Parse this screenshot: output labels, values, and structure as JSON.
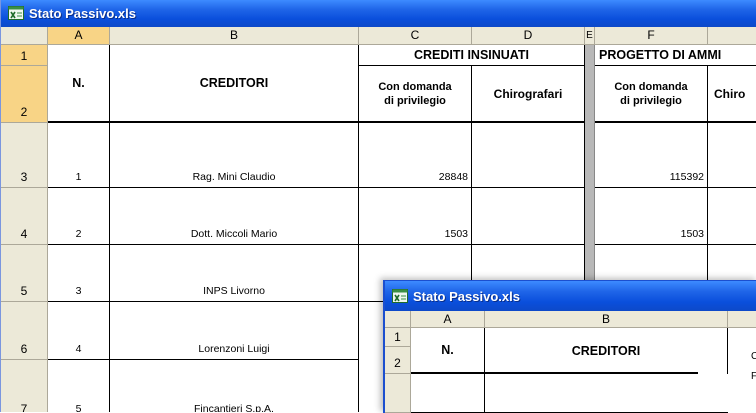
{
  "window_main": {
    "title": "Stato Passivo.xls",
    "columns": [
      "A",
      "B",
      "C",
      "D",
      "E",
      "F"
    ],
    "row_headers": [
      "1",
      "2",
      "3",
      "4",
      "5",
      "6",
      "7"
    ],
    "header": {
      "n_label": "N.",
      "creditori_label": "CREDITORI",
      "crediti_insinuati": "CREDITI INSINUATI",
      "progetto": "PROGETTO DI AMMI",
      "con_domanda": "Con domanda di privilegio",
      "con_domanda_line1": "Con domanda",
      "con_domanda_line2": "di privilegio",
      "chirografari": "Chirografari",
      "chiro_partial": "Chiro"
    },
    "rows": [
      {
        "n": "1",
        "creditore": "Rag. Mini Claudio",
        "c": "28848",
        "f": "115392"
      },
      {
        "n": "2",
        "creditore": "Dott. Miccoli Mario",
        "c": "1503",
        "f": "1503"
      },
      {
        "n": "3",
        "creditore": "INPS Livorno",
        "c": "",
        "f": ""
      },
      {
        "n": "4",
        "creditore": "Lorenzoni Luigi",
        "c": "",
        "f": ""
      },
      {
        "n": "5",
        "creditore": "Fincantieri S.p.A.",
        "c": "",
        "f": ""
      }
    ]
  },
  "window_second": {
    "title": "Stato Passivo.xls",
    "columns": [
      "A",
      "B"
    ],
    "row_headers": [
      "1",
      "2"
    ],
    "n_label": "N.",
    "creditori_label": "CREDITORI",
    "edge_chars": [
      "C",
      "F"
    ]
  },
  "colors": {
    "titlebar": "#0a4fdc",
    "header_bg": "#ece9d8",
    "selected_header": "#f8d486"
  }
}
